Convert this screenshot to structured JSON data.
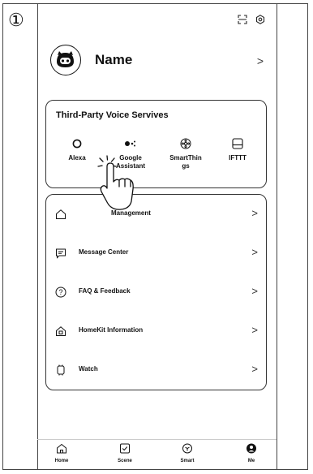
{
  "step": {
    "number": "①"
  },
  "profile": {
    "name": "Name",
    "chevron": ">"
  },
  "voice_services": {
    "title": "Third-Party Voice Servives",
    "items": [
      {
        "label": "Alexa",
        "icon": "alexa-icon"
      },
      {
        "label": "Google\nAssistant",
        "icon": "google-assistant-icon"
      },
      {
        "label": "SmartThin\ngs",
        "icon": "smartthings-icon"
      },
      {
        "label": "IFTTT",
        "icon": "ifttt-icon"
      }
    ]
  },
  "menu": {
    "items": [
      {
        "label": "Management",
        "icon": "home-icon",
        "chevron": ">"
      },
      {
        "label": "Message Center",
        "icon": "message-icon",
        "chevron": ">"
      },
      {
        "label": "FAQ & Feedback",
        "icon": "help-icon",
        "chevron": ">"
      },
      {
        "label": "HomeKit Information",
        "icon": "homekit-icon",
        "chevron": ">"
      },
      {
        "label": "Watch",
        "icon": "watch-icon",
        "chevron": ">"
      }
    ]
  },
  "tabbar": {
    "tabs": [
      {
        "label": "Home",
        "icon": "home-tab-icon"
      },
      {
        "label": "Scene",
        "icon": "scene-tab-icon"
      },
      {
        "label": "Smart",
        "icon": "smart-tab-icon"
      },
      {
        "label": "Me",
        "icon": "me-tab-icon",
        "active": true
      }
    ]
  },
  "icons": [
    "scan-icon",
    "settings-icon",
    "hand-pointer-icon"
  ]
}
